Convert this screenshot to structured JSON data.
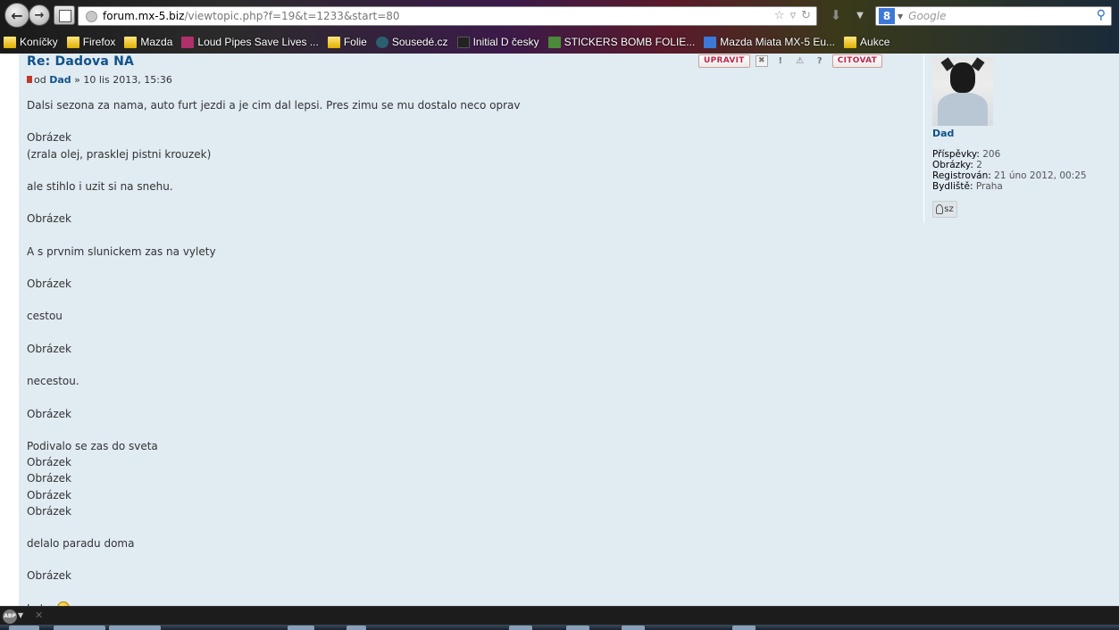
{
  "browser": {
    "url_host": "forum.mx-5.biz",
    "url_path": "/viewtopic.php?f=19&t=1233&start=80",
    "search_placeholder": "Google",
    "bookmarks": [
      {
        "label": "Koníčky",
        "icon": "folder-icon"
      },
      {
        "label": "Firefox",
        "icon": "folder-icon"
      },
      {
        "label": "Mazda",
        "icon": "folder-icon"
      },
      {
        "label": "Loud Pipes Save Lives ...",
        "icon": "guitar-icon"
      },
      {
        "label": "Folie",
        "icon": "folder-icon"
      },
      {
        "label": "Sousedé.cz",
        "icon": "site-icon"
      },
      {
        "label": "Initial D česky",
        "icon": "dark-site-icon"
      },
      {
        "label": "STICKERS BOMB FOLIE...",
        "icon": "sticker-icon"
      },
      {
        "label": "Mazda Miata MX-5 Eu...",
        "icon": "google-icon"
      },
      {
        "label": "Aukce",
        "icon": "folder-icon"
      }
    ]
  },
  "post": {
    "title": "Re: Dadova NA",
    "by_label": "od",
    "author": "Dad",
    "date": "» 10 lis 2013, 15:36",
    "actions": {
      "edit": "UPRAVIT",
      "quote": "CITOVAT"
    },
    "lines": [
      "Dalsi sezona za nama, auto furt jezdi a je cim dal lepsi. Pres zimu se mu dostalo neco oprav",
      "",
      "Obrázek",
      "(zrala olej, prasklej pistni krouzek)",
      "",
      "ale stihlo i uzit si na snehu.",
      "",
      "Obrázek",
      "",
      "A s prvnim slunickem zas na vylety",
      "",
      "Obrázek",
      "",
      "cestou",
      "",
      "Obrázek",
      "",
      "necestou.",
      "",
      "Obrázek",
      "",
      "Podivalo se zas do sveta",
      "Obrázek",
      "Obrázek",
      "Obrázek",
      "Obrázek",
      "",
      "delalo paradu doma",
      "",
      "Obrázek",
      "",
      "Je to "
    ]
  },
  "profile": {
    "name": "Dad",
    "stats": [
      {
        "label": "Příspěvky:",
        "value": "206"
      },
      {
        "label": "Obrázky:",
        "value": "2"
      },
      {
        "label": "Registrován:",
        "value": "21 úno 2012, 00:25"
      },
      {
        "label": "Bydliště:",
        "value": "Praha"
      }
    ],
    "contact_label": "sz"
  },
  "statusbar": {
    "abp_label": "ABP"
  }
}
